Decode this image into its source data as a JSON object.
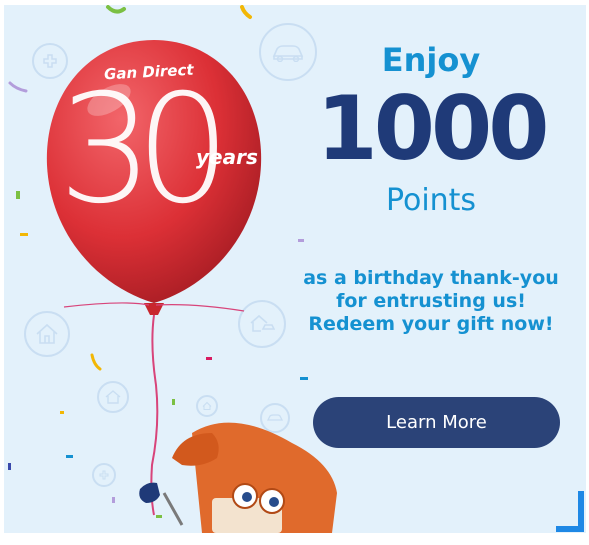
{
  "brand": {
    "name": "Gan Direct",
    "years_number": "30",
    "years_word": "years"
  },
  "headline": {
    "enjoy": "Enjoy",
    "amount": "1000",
    "unit": "Points"
  },
  "message": {
    "line1": "as a birthday thank-you",
    "line2": "for entrusting us!",
    "line3": "Redeem your gift now!"
  },
  "cta": {
    "label": "Learn More"
  },
  "colors": {
    "background": "#e3f1fb",
    "accent_blue": "#1591d1",
    "navy": "#1f3a78",
    "button": "#2b4378",
    "balloon": "#dc3036",
    "phone": "#e06a2c"
  },
  "icons": [
    "car-icon",
    "home-icon",
    "plus-icon",
    "house-car-icon"
  ]
}
